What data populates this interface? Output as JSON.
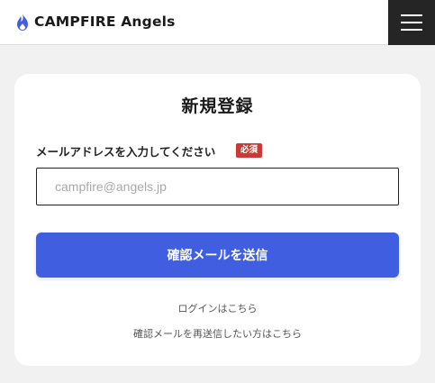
{
  "header": {
    "logo_text": "CAMPFIRE Angels",
    "logo_icon": "flame-icon",
    "menu_icon": "hamburger-menu-icon"
  },
  "form": {
    "title": "新規登録",
    "email_label": "メールアドレスを入力してください",
    "required_badge": "必須",
    "email_placeholder": "campfire@angels.jp",
    "email_value": "",
    "submit_label": "確認メールを送信"
  },
  "links": {
    "login": "ログインはこちら",
    "resend": "確認メールを再送信したい方はこちら"
  },
  "colors": {
    "accent": "#3f5ee0",
    "required": "#c93a36",
    "menu_bg": "#252525",
    "page_bg": "#f1f1f1"
  }
}
